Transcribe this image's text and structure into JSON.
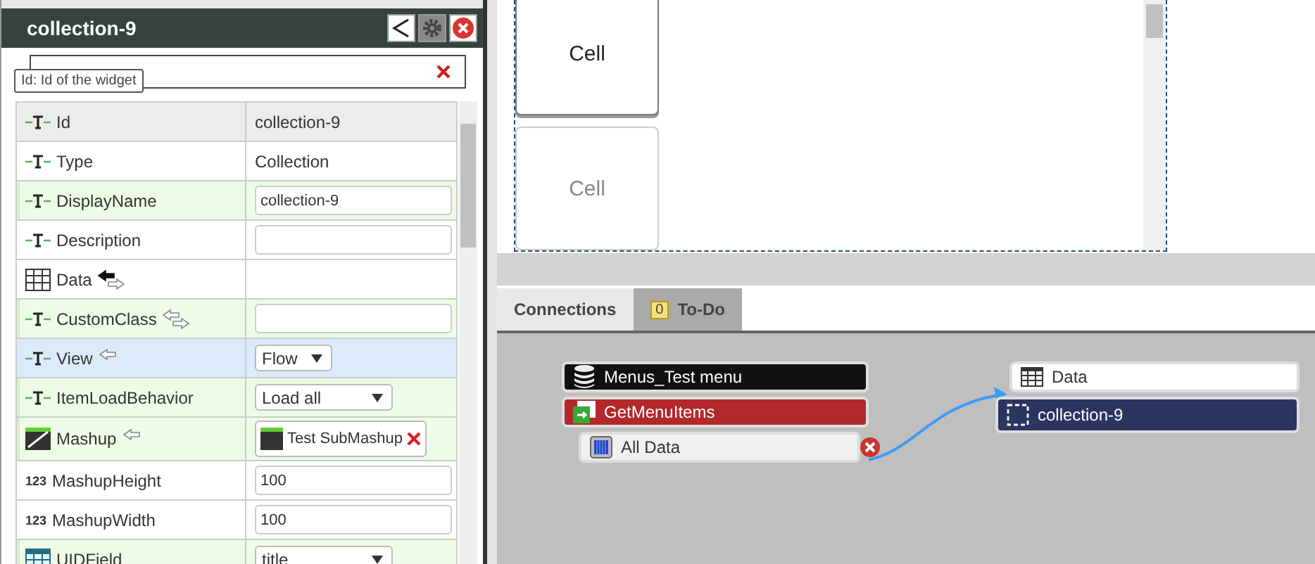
{
  "panel": {
    "title": "collection-9",
    "tooltip": "Id: Id of the widget"
  },
  "rows": [
    {
      "label": "Id",
      "kind": "string",
      "hovered": true,
      "modified": false,
      "selected": false,
      "bindable_target": false,
      "bound": false,
      "bindable_source": false,
      "value": {
        "kind": "text",
        "text": "collection-9"
      }
    },
    {
      "label": "Type",
      "kind": "string",
      "hovered": false,
      "modified": false,
      "selected": false,
      "bindable_target": false,
      "bound": false,
      "bindable_source": false,
      "value": {
        "kind": "text",
        "text": "Collection"
      }
    },
    {
      "label": "DisplayName",
      "kind": "string",
      "hovered": false,
      "modified": true,
      "selected": false,
      "bindable_target": false,
      "bound": false,
      "bindable_source": false,
      "value": {
        "kind": "input",
        "text": "collection-9"
      }
    },
    {
      "label": "Description",
      "kind": "string",
      "hovered": false,
      "modified": false,
      "selected": false,
      "bindable_target": false,
      "bound": false,
      "bindable_source": false,
      "value": {
        "kind": "input"
      }
    },
    {
      "label": "Data",
      "kind": "infotable",
      "hovered": false,
      "modified": false,
      "selected": false,
      "bindable_target": true,
      "bound": true,
      "bindable_source": true
    },
    {
      "label": "CustomClass",
      "kind": "string",
      "hovered": false,
      "modified": true,
      "selected": false,
      "bindable_target": true,
      "bound": false,
      "bindable_source": true,
      "value": {
        "kind": "input"
      }
    },
    {
      "label": "View",
      "kind": "string",
      "hovered": false,
      "modified": false,
      "selected": true,
      "bindable_target": true,
      "bound": false,
      "bindable_source": false,
      "value": {
        "kind": "select",
        "text": "Flow"
      }
    },
    {
      "label": "ItemLoadBehavior",
      "kind": "string",
      "hovered": false,
      "modified": true,
      "selected": false,
      "bindable_target": false,
      "bound": false,
      "bindable_source": false,
      "value": {
        "kind": "select",
        "text": "Load all"
      }
    },
    {
      "label": "Mashup",
      "kind": "mashup",
      "hovered": false,
      "modified": true,
      "selected": false,
      "bindable_target": true,
      "bound": false,
      "bindable_source": false,
      "value": {
        "kind": "mashup",
        "text": "Test SubMashup"
      }
    },
    {
      "label": "MashupHeight",
      "kind": "number",
      "icon_text": "123",
      "hovered": false,
      "modified": false,
      "selected": false,
      "bindable_target": false,
      "bound": false,
      "bindable_source": false,
      "value": {
        "kind": "input",
        "text": "100"
      }
    },
    {
      "label": "MashupWidth",
      "kind": "number",
      "icon_text": "123",
      "hovered": false,
      "modified": false,
      "selected": false,
      "bindable_target": false,
      "bound": false,
      "bindable_source": false,
      "value": {
        "kind": "input",
        "text": "100"
      }
    },
    {
      "label": "UIDField",
      "kind": "field",
      "hovered": false,
      "modified": true,
      "selected": false,
      "bindable_target": false,
      "bound": false,
      "bindable_source": false,
      "value": {
        "kind": "select",
        "text": "title"
      }
    }
  ],
  "cells": [
    {
      "label": "Cell",
      "selected": true
    },
    {
      "label": "Cell",
      "selected": false
    }
  ],
  "tabs": [
    {
      "label": "Connections",
      "selected": true
    },
    {
      "label": "To-Do",
      "selected": false,
      "badge": "0"
    }
  ],
  "connections": {
    "sources": [
      {
        "label": "Menus_Test menu",
        "kind": "thing"
      },
      {
        "label": "GetMenuItems",
        "kind": "service"
      },
      {
        "label": "All Data",
        "kind": "output"
      }
    ],
    "targets": [
      {
        "label": "Data",
        "kind": "property"
      },
      {
        "label": "collection-9",
        "kind": "widget"
      }
    ]
  }
}
